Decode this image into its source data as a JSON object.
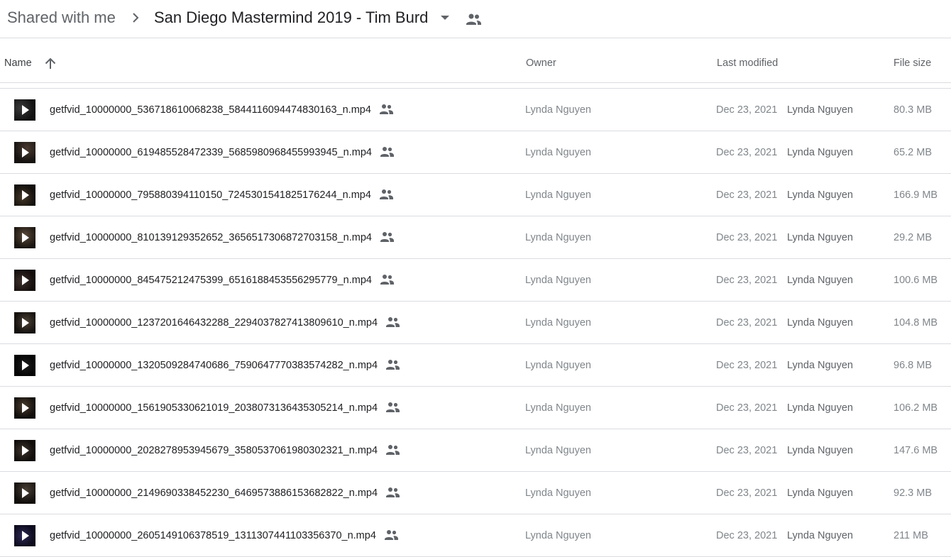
{
  "breadcrumb": {
    "root": "Shared with me",
    "current": "San Diego Mastermind 2019 - Tim Burd"
  },
  "columns": {
    "name": "Name",
    "owner": "Owner",
    "last_modified": "Last modified",
    "file_size": "File size"
  },
  "icons": {
    "separator": "chevron-right-icon",
    "dropdown": "arrow-drop-down-icon",
    "shared": "people-icon",
    "sort": "arrow-upward-icon",
    "thumbnail_overlay": "play-icon"
  },
  "colors": {
    "icon": "#5f6368",
    "divider": "#dadce0",
    "text_primary": "#202124",
    "text_secondary": "#80868b"
  },
  "files": [
    {
      "name": "getfvid_10000000_536718610068238_5844116094474830163_n.mp4",
      "owner": "Lynda Nguyen",
      "modified_date": "Dec 23, 2021",
      "modified_by": "Lynda Nguyen",
      "size": "80.3 MB",
      "shared": true
    },
    {
      "name": "getfvid_10000000_619485528472339_5685980968455993945_n.mp4",
      "owner": "Lynda Nguyen",
      "modified_date": "Dec 23, 2021",
      "modified_by": "Lynda Nguyen",
      "size": "65.2 MB",
      "shared": true
    },
    {
      "name": "getfvid_10000000_795880394110150_7245301541825176244_n.mp4",
      "owner": "Lynda Nguyen",
      "modified_date": "Dec 23, 2021",
      "modified_by": "Lynda Nguyen",
      "size": "166.9 MB",
      "shared": true
    },
    {
      "name": "getfvid_10000000_810139129352652_3656517306872703158_n.mp4",
      "owner": "Lynda Nguyen",
      "modified_date": "Dec 23, 2021",
      "modified_by": "Lynda Nguyen",
      "size": "29.2 MB",
      "shared": true
    },
    {
      "name": "getfvid_10000000_845475212475399_6516188453556295779_n.mp4",
      "owner": "Lynda Nguyen",
      "modified_date": "Dec 23, 2021",
      "modified_by": "Lynda Nguyen",
      "size": "100.6 MB",
      "shared": true
    },
    {
      "name": "getfvid_10000000_1237201646432288_2294037827413809610_n.mp4",
      "owner": "Lynda Nguyen",
      "modified_date": "Dec 23, 2021",
      "modified_by": "Lynda Nguyen",
      "size": "104.8 MB",
      "shared": true
    },
    {
      "name": "getfvid_10000000_1320509284740686_7590647770383574282_n.mp4",
      "owner": "Lynda Nguyen",
      "modified_date": "Dec 23, 2021",
      "modified_by": "Lynda Nguyen",
      "size": "96.8 MB",
      "shared": true
    },
    {
      "name": "getfvid_10000000_1561905330621019_2038073136435305214_n.mp4",
      "owner": "Lynda Nguyen",
      "modified_date": "Dec 23, 2021",
      "modified_by": "Lynda Nguyen",
      "size": "106.2 MB",
      "shared": true
    },
    {
      "name": "getfvid_10000000_2028278953945679_3580537061980302321_n.mp4",
      "owner": "Lynda Nguyen",
      "modified_date": "Dec 23, 2021",
      "modified_by": "Lynda Nguyen",
      "size": "147.6 MB",
      "shared": true
    },
    {
      "name": "getfvid_10000000_2149690338452230_6469573886153682822_n.mp4",
      "owner": "Lynda Nguyen",
      "modified_date": "Dec 23, 2021",
      "modified_by": "Lynda Nguyen",
      "size": "92.3 MB",
      "shared": true
    },
    {
      "name": "getfvid_10000000_2605149106378519_1311307441103356370_n.mp4",
      "owner": "Lynda Nguyen",
      "modified_date": "Dec 23, 2021",
      "modified_by": "Lynda Nguyen",
      "size": "211 MB",
      "shared": true
    }
  ]
}
